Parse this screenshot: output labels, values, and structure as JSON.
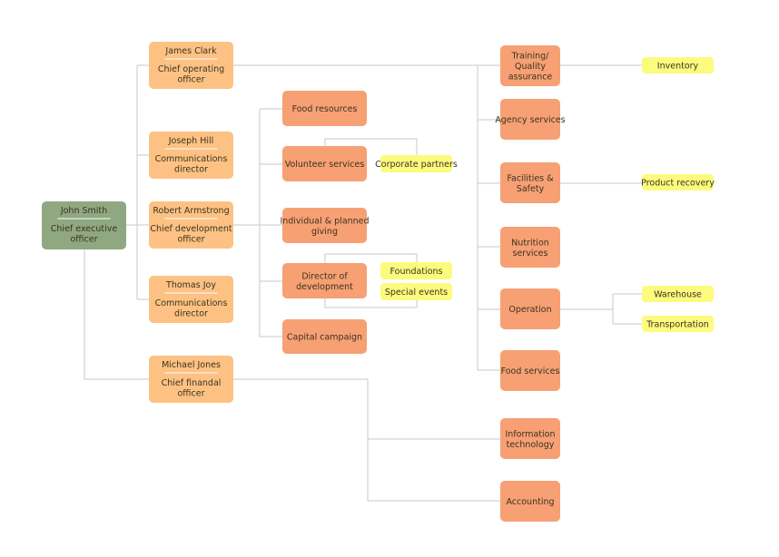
{
  "colors": {
    "ceo": "#8fa882",
    "exec": "#fdc283",
    "dept": "#f7a074",
    "unit": "#fdfb7d",
    "line": "#c8c8c8"
  },
  "ceo": {
    "name": "John Smith",
    "title": [
      "Chief executive",
      "officer"
    ]
  },
  "execs": [
    {
      "id": "james-clark",
      "name": "James Clark",
      "title": [
        "Chief operating",
        "officer"
      ]
    },
    {
      "id": "joseph-hill",
      "name": "Joseph Hill",
      "title": [
        "Communications",
        "director"
      ]
    },
    {
      "id": "robert-armstrong",
      "name": "Robert Armstrong",
      "title": [
        "Chief development",
        "officer"
      ]
    },
    {
      "id": "thomas-joy",
      "name": "Thomas Joy",
      "title": [
        "Communications",
        "director"
      ]
    },
    {
      "id": "michael-jones",
      "name": "Michael Jones",
      "title": [
        "Chief finandal",
        "officer"
      ]
    }
  ],
  "development": [
    {
      "id": "food-resources",
      "label": [
        "Food resources"
      ]
    },
    {
      "id": "volunteer-services",
      "label": [
        "Volunteer services"
      ]
    },
    {
      "id": "individual-planned-giving",
      "label": [
        "Individual & planned",
        "giving"
      ]
    },
    {
      "id": "director-of-development",
      "label": [
        "Director of",
        "development"
      ]
    },
    {
      "id": "capital-campaign",
      "label": [
        "Capital campaign"
      ]
    }
  ],
  "development_units": [
    {
      "id": "corporate-partners",
      "label": "Corporate partners"
    },
    {
      "id": "foundations",
      "label": "Foundations"
    },
    {
      "id": "special-events",
      "label": "Special events"
    }
  ],
  "operations": [
    {
      "id": "training-quality-assurance",
      "label": [
        "Training/",
        "Quality",
        "assurance"
      ]
    },
    {
      "id": "agency-services",
      "label": [
        "Agency services"
      ]
    },
    {
      "id": "facilities-safety",
      "label": [
        "Facilities &",
        "Safety"
      ]
    },
    {
      "id": "nutrition-services",
      "label": [
        "Nutrition",
        "services"
      ]
    },
    {
      "id": "operation",
      "label": [
        "Operation"
      ]
    },
    {
      "id": "food-services",
      "label": [
        "Food services"
      ]
    },
    {
      "id": "information-technology",
      "label": [
        "Information",
        "technology"
      ]
    },
    {
      "id": "accounting",
      "label": [
        "Accounting"
      ]
    }
  ],
  "operation_units": [
    {
      "id": "inventory",
      "label": "Inventory"
    },
    {
      "id": "product-recovery",
      "label": "Product recovery"
    },
    {
      "id": "warehouse",
      "label": "Warehouse"
    },
    {
      "id": "transportation",
      "label": "Transportation"
    }
  ]
}
